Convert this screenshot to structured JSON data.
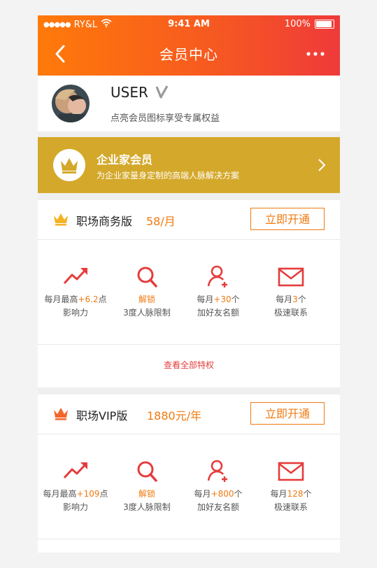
{
  "status_bar": {
    "carrier": "RY&L",
    "time": "9:41 AM",
    "battery": "100%"
  },
  "nav": {
    "title": "会员中心"
  },
  "user": {
    "name": "USER",
    "subtitle": "点亮会员图标享受专属权益"
  },
  "enterprise": {
    "title": "企业家会员",
    "subtitle": "为企业家量身定制的高端人脉解决方案"
  },
  "plans": [
    {
      "name": "职场商务版",
      "price": "58/月",
      "button": "立即开通",
      "benefits": [
        {
          "l1_pre": "每月最高",
          "l1_hl": "+6.2",
          "l1_post": "点",
          "l2": "影响力"
        },
        {
          "l1_pre": "",
          "l1_hl": "解锁",
          "l1_post": "",
          "l2": "3度人脉限制"
        },
        {
          "l1_pre": "每月",
          "l1_hl": "+30",
          "l1_post": "个",
          "l2": "加好友名额"
        },
        {
          "l1_pre": "每月",
          "l1_hl": "3",
          "l1_post": "个",
          "l2": "极速联系"
        }
      ],
      "see_all": "查看全部特权"
    },
    {
      "name": "职场VIP版",
      "price": "1880元/年",
      "button": "立即开通",
      "benefits": [
        {
          "l1_pre": "每月最高",
          "l1_hl": "+109",
          "l1_post": "点",
          "l2": "影响力"
        },
        {
          "l1_pre": "",
          "l1_hl": "解锁",
          "l1_post": "",
          "l2": "3度人脉限制"
        },
        {
          "l1_pre": "每月",
          "l1_hl": "+800",
          "l1_post": "个",
          "l2": "加好友名额"
        },
        {
          "l1_pre": "每月",
          "l1_hl": "128",
          "l1_post": "个",
          "l2": "极速联系"
        }
      ]
    }
  ],
  "colors": {
    "accent": "#f07a10",
    "header_start": "#ff7a0a",
    "header_end": "#ef3a3a",
    "enterprise_gold": "#d4a82a",
    "icon_red": "#e53c3c",
    "crown_gold": "#f5b324",
    "crown_orange": "#f2662b"
  },
  "icons": [
    "back-arrow-icon",
    "more-dots-icon",
    "v-badge-icon",
    "crown-icon",
    "chevron-right-icon",
    "trend-up-icon",
    "search-icon",
    "add-user-icon",
    "mail-icon"
  ]
}
